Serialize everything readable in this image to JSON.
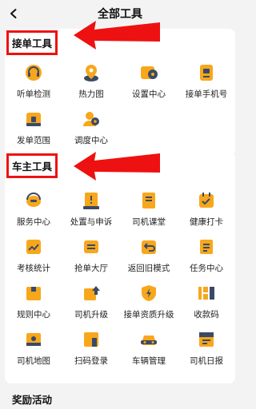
{
  "header": {
    "title": "全部工具",
    "back_icon": "chevron-left-icon"
  },
  "sections": {
    "order_tools": {
      "title": "接单工具",
      "items": [
        {
          "label": "听单检测",
          "icon": "headset-check-icon"
        },
        {
          "label": "热力图",
          "icon": "location-pin-icon"
        },
        {
          "label": "设置中心",
          "icon": "gear-icon"
        },
        {
          "label": "接单手机号",
          "icon": "phone-card-icon"
        },
        {
          "label": "发单范围",
          "icon": "range-bag-icon"
        },
        {
          "label": "调度中心",
          "icon": "dispatch-people-icon"
        }
      ]
    },
    "driver_tools": {
      "title": "车主工具",
      "items": [
        {
          "label": "服务中心",
          "icon": "headset-icon"
        },
        {
          "label": "处置与申诉",
          "icon": "alert-document-icon"
        },
        {
          "label": "司机课堂",
          "icon": "book-icon"
        },
        {
          "label": "健康打卡",
          "icon": "calendar-check-icon"
        },
        {
          "label": "考核统计",
          "icon": "chart-trend-icon"
        },
        {
          "label": "抢单大厅",
          "icon": "order-card-icon"
        },
        {
          "label": "返回旧模式",
          "icon": "return-icon"
        },
        {
          "label": "任务中心",
          "icon": "task-list-icon"
        },
        {
          "label": "规则中心",
          "icon": "rule-box-icon"
        },
        {
          "label": "司机升级",
          "icon": "upgrade-arrow-icon"
        },
        {
          "label": "接单资质升级",
          "icon": "shield-lightning-icon"
        },
        {
          "label": "收款码",
          "icon": "qr-code-icon"
        },
        {
          "label": "司机地图",
          "icon": "map-icon"
        },
        {
          "label": "扫码登录",
          "icon": "scan-login-icon"
        },
        {
          "label": "车辆管理",
          "icon": "car-icon"
        },
        {
          "label": "司机日报",
          "icon": "daily-report-icon"
        }
      ]
    },
    "rewards": {
      "title": "奖励活动"
    }
  },
  "colors": {
    "accent": "#f7a71c",
    "accent_dark": "#3a4a66",
    "highlight_border": "#ee1111",
    "annotation_arrow": "#ee1111",
    "background": "#f3f3f3"
  }
}
